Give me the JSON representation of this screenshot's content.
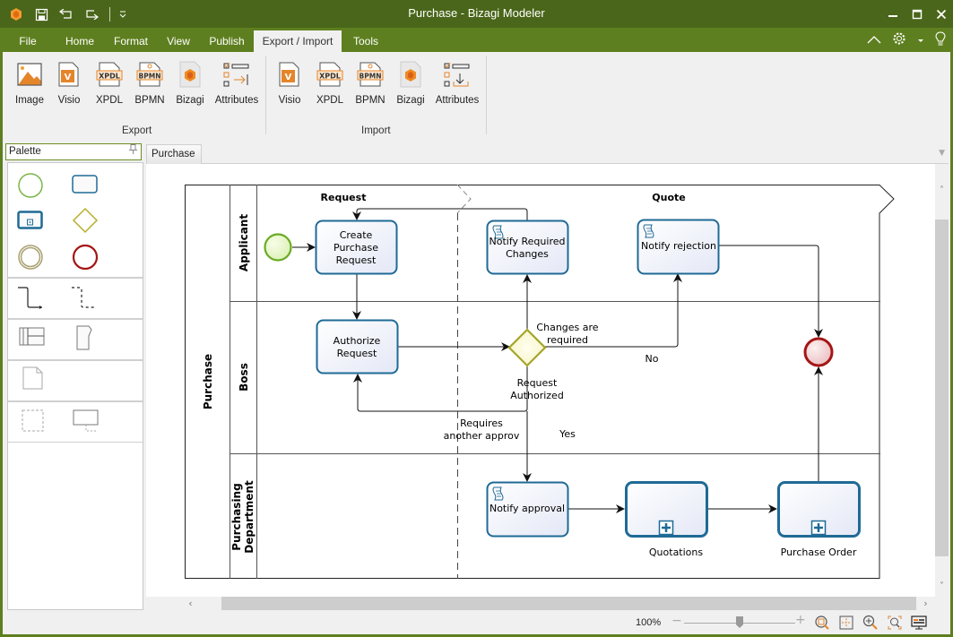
{
  "window": {
    "title": "Purchase - Bizagi Modeler",
    "minimize": "minimize",
    "maximize": "maximize",
    "close": "close"
  },
  "quick_access": {
    "icons": [
      "bizagi-logo-icon",
      "save-icon",
      "undo-icon",
      "redo-icon",
      "customize-dropdown-icon"
    ]
  },
  "menu": {
    "tabs": [
      {
        "label": "File"
      },
      {
        "label": "Home"
      },
      {
        "label": "Format"
      },
      {
        "label": "View"
      },
      {
        "label": "Publish"
      },
      {
        "label": "Export / Import",
        "active": true
      },
      {
        "label": "Tools"
      }
    ],
    "right_icons": [
      "collapse-ribbon-icon",
      "settings-gear-icon",
      "dropdown-icon",
      "lightbulb-icon"
    ]
  },
  "ribbon": {
    "export": {
      "label": "Export",
      "buttons": [
        {
          "label": "Image"
        },
        {
          "label": "Visio"
        },
        {
          "label": "XPDL"
        },
        {
          "label": "BPMN"
        },
        {
          "label": "Bizagi"
        },
        {
          "label": "Attributes"
        }
      ]
    },
    "import": {
      "label": "Import",
      "buttons": [
        {
          "label": "Visio"
        },
        {
          "label": "XPDL"
        },
        {
          "label": "BPMN"
        },
        {
          "label": "Bizagi"
        },
        {
          "label": "Attributes"
        }
      ]
    },
    "icon_text": {
      "xpdl": "XPDL",
      "bpmn": "BPMN",
      "visio": "V"
    }
  },
  "palette": {
    "title": "Palette",
    "pin": "⍑",
    "items": [
      "start-event",
      "task",
      "sub-process",
      "gateway",
      "intermediate-event",
      "end-event",
      "sequence-flow",
      "association",
      "pool",
      "lane",
      "data-object",
      "group",
      "annotation"
    ]
  },
  "document": {
    "tab": "Purchase",
    "dropdown": "▼"
  },
  "diagram": {
    "pool": "Purchase",
    "lanes": [
      "Applicant",
      "Boss",
      "Purchasing Department"
    ],
    "phases": [
      "Request",
      "Quote"
    ],
    "tasks": {
      "create": [
        "Create",
        "Purchase",
        "Request"
      ],
      "authorize": [
        "Authorize",
        "Request"
      ],
      "notify_changes": [
        "Notify Required",
        "Changes"
      ],
      "notify_rejection": "Notify rejection",
      "notify_approval": "Notify approval",
      "quotations": "Quotations",
      "purchase_order": "Purchase Order"
    },
    "labels": {
      "changes_required": [
        "Changes are",
        "required"
      ],
      "request_authorized": [
        "Request",
        "Authorized"
      ],
      "requires_another": [
        "Requires",
        "another approv"
      ],
      "no": "No",
      "yes": "Yes"
    },
    "colors": {
      "task_stroke": "#1f6a96",
      "task_fill": "#eef2fb",
      "start_stroke": "#6aab23",
      "end_stroke": "#a51515",
      "gateway_stroke": "#a6a52a"
    }
  },
  "scroll": {
    "up": "˄",
    "down": "˅",
    "left": "‹",
    "right": "›"
  },
  "status": {
    "zoom": "100%",
    "zoom_minus": "−",
    "zoom_plus": "+",
    "zoom_fraction": 0.5,
    "icons": [
      "zoom-fit-icon",
      "center-icon",
      "zoom-in-icon",
      "zoom-area-icon",
      "presentation-icon"
    ]
  }
}
